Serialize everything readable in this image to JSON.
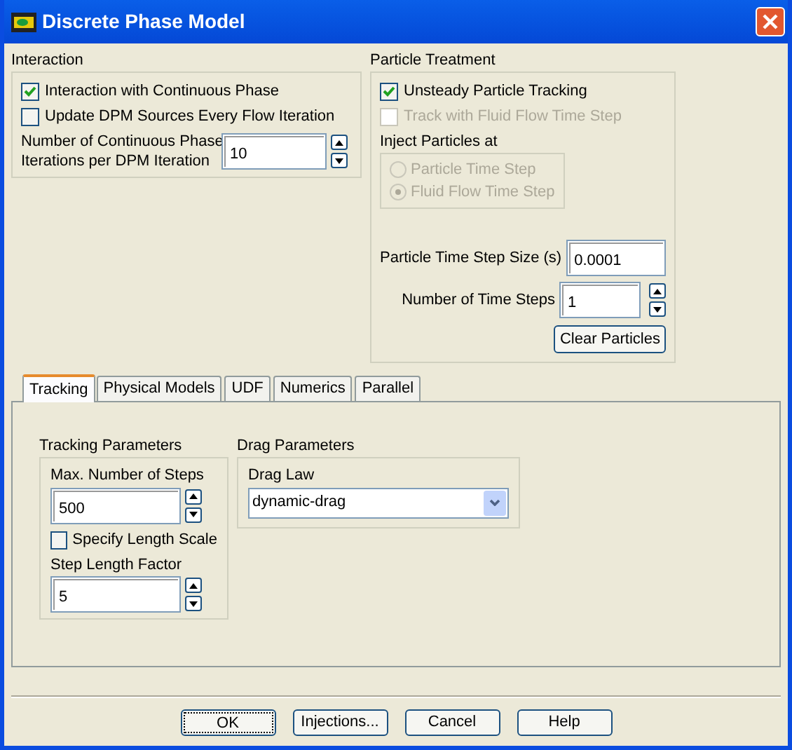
{
  "window": {
    "title": "Discrete Phase Model"
  },
  "interaction": {
    "title": "Interaction",
    "options": [
      {
        "label": "Interaction with Continuous Phase",
        "checked": true,
        "disabled": false
      },
      {
        "label": "Update DPM Sources Every Flow Iteration",
        "checked": false,
        "disabled": false
      }
    ],
    "iterations": {
      "label": "Number of Continuous Phase\nIterations per DPM Iteration",
      "value": "10"
    }
  },
  "particle_treatment": {
    "title": "Particle Treatment",
    "options": [
      {
        "label": "Unsteady Particle Tracking",
        "checked": true,
        "disabled": false
      },
      {
        "label": "Track with Fluid Flow Time Step",
        "checked": false,
        "disabled": true
      }
    ],
    "inject": {
      "title": "Inject Particles at",
      "radios": [
        {
          "label": "Particle Time Step",
          "selected": false,
          "disabled": true
        },
        {
          "label": "Fluid Flow Time Step",
          "selected": true,
          "disabled": true
        }
      ]
    },
    "time_step_size": {
      "label": "Particle Time Step Size (s)",
      "value": "0.0001"
    },
    "num_time_steps": {
      "label": "Number of Time Steps",
      "value": "1"
    },
    "clear_button": "Clear Particles"
  },
  "tabs": [
    {
      "label": "Tracking",
      "selected": true
    },
    {
      "label": "Physical Models",
      "selected": false
    },
    {
      "label": "UDF",
      "selected": false
    },
    {
      "label": "Numerics",
      "selected": false
    },
    {
      "label": "Parallel",
      "selected": false
    }
  ],
  "tracking": {
    "title": "Tracking Parameters",
    "max_steps": {
      "label": "Max. Number of Steps",
      "value": "500"
    },
    "specify_length_scale": {
      "label": "Specify Length Scale",
      "checked": false
    },
    "step_length_factor": {
      "label": "Step Length Factor",
      "value": "5"
    }
  },
  "drag": {
    "title": "Drag Parameters",
    "drag_law": {
      "label": "Drag Law",
      "value": "dynamic-drag"
    }
  },
  "buttons": [
    {
      "label": "OK",
      "focused": true
    },
    {
      "label": "Injections...",
      "focused": false
    },
    {
      "label": "Cancel",
      "focused": false
    },
    {
      "label": "Help",
      "focused": false
    }
  ]
}
